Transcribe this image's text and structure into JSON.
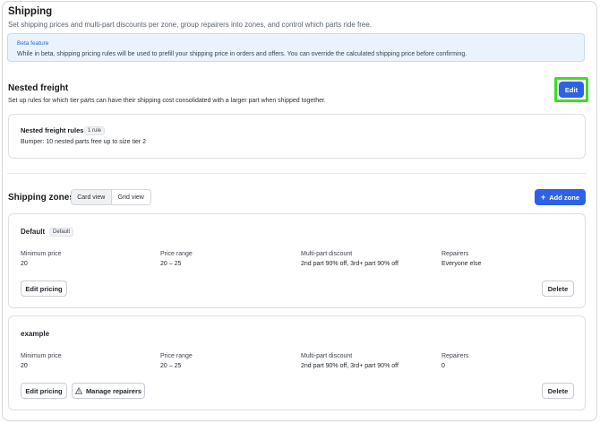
{
  "header": {
    "title": "Shipping",
    "subtitle": "Set shipping prices and multi-part discounts per zone, group repairers into zones, and control which parts ride free."
  },
  "beta": {
    "title": "Beta feature",
    "text": "While in beta, shipping pricing rules will be used to prefill your shipping price in orders and offers. You can override the calculated shipping price before confirming."
  },
  "nested": {
    "title": "Nested freight",
    "subtitle": "Set up rules for which tier parts can have their shipping cost consolidated with a larger part when shipped together.",
    "edit_label": "Edit",
    "rules_title": "Nested freight rules",
    "rules_count": "1 rule",
    "rule_text": "Bumper: 10 nested parts free up to size tier 2"
  },
  "zones": {
    "title": "Shipping zones",
    "view_card": "Card view",
    "view_grid": "Grid view",
    "add_label": "Add zone",
    "col_labels": {
      "min": "Minimum price",
      "range": "Price range",
      "discount": "Multi-part discount",
      "repairers": "Repairers"
    },
    "cards": [
      {
        "name": "Default",
        "badge": "Default",
        "min": "20",
        "range": "20 – 25",
        "discount": "2nd part 90% off, 3rd+ part 90% off",
        "repairers": "Everyone else",
        "edit_pricing": "Edit pricing",
        "delete": "Delete"
      },
      {
        "name": "example",
        "min": "20",
        "range": "20 – 25",
        "discount": "2nd part 90% off, 3rd+ part 90% off",
        "repairers": "0",
        "edit_pricing": "Edit pricing",
        "manage": "Manage repairers",
        "delete": "Delete"
      }
    ]
  },
  "icons": {
    "add": "plus-icon",
    "manage": "warning-triangle-icon"
  },
  "colors": {
    "primary": "#2d62e6",
    "beta_bg": "#eaf2fd",
    "highlight": "#3edc27"
  }
}
